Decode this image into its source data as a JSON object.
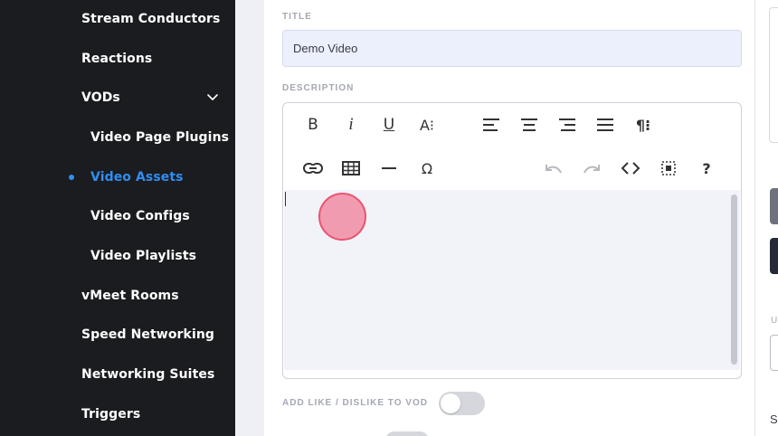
{
  "sidebar": {
    "items": [
      {
        "label": "Stream Conductors"
      },
      {
        "label": "Reactions"
      },
      {
        "label": "VODs"
      },
      {
        "label": "Video Page Plugins"
      },
      {
        "label": "Video Assets"
      },
      {
        "label": "Video Configs"
      },
      {
        "label": "Video Playlists"
      },
      {
        "label": "vMeet Rooms"
      },
      {
        "label": "Speed Networking"
      },
      {
        "label": "Networking Suites"
      },
      {
        "label": "Triggers"
      }
    ],
    "active_item": "Video Assets",
    "active_color": "#2f8ef4"
  },
  "form": {
    "title_label": "TITLE",
    "title_value": "Demo Video",
    "description_label": "DESCRIPTION",
    "like_dislike_label": "ADD LIKE / DISLIKE TO VOD",
    "like_dislike_enabled": false
  },
  "editor": {
    "toolbar_row1": [
      "bold-icon",
      "italic-icon",
      "underline-icon",
      "font-size-icon",
      "align-left-icon",
      "align-center-icon",
      "align-right-icon",
      "align-justify-icon",
      "paragraph-icon"
    ],
    "toolbar_row2": [
      "link-icon",
      "table-icon",
      "horizontal-rule-icon",
      "special-char-icon",
      "undo-icon",
      "redo-icon",
      "code-view-icon",
      "select-all-icon",
      "help-icon"
    ],
    "bold_glyph": "B",
    "italic_glyph": "i",
    "underline_glyph": "U",
    "font_size_glyph": "A⁝",
    "paragraph_glyph": "¶⁝",
    "omega_glyph": "Ω",
    "help_glyph": "?",
    "content": ""
  },
  "right_column": {
    "frag_u": "U",
    "frag_s": "S"
  }
}
